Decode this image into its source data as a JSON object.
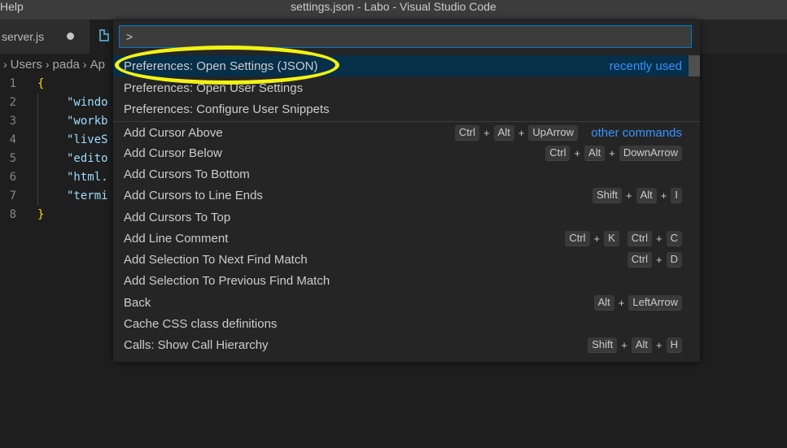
{
  "menu": {
    "help": "Help"
  },
  "window": {
    "title": "settings.json - Labo - Visual Studio Code"
  },
  "tabs": [
    {
      "label": "server.js",
      "modified": true
    },
    {
      "label": "",
      "icon": "file-icon"
    }
  ],
  "breadcrumb": [
    "Users",
    "pada",
    "Ap"
  ],
  "editor": {
    "line_numbers": [
      "1",
      "2",
      "3",
      "4",
      "5",
      "6",
      "7",
      "8"
    ],
    "lines": [
      "{",
      "\"windo",
      "\"workb",
      "\"liveS",
      "\"edito",
      "\"html.",
      "\"termi",
      "}"
    ]
  },
  "palette": {
    "input_value": ">",
    "items": [
      {
        "label": "Preferences: Open Settings (JSON)",
        "tag": "recently used",
        "keys": []
      },
      {
        "label": "Preferences: Open User Settings",
        "tag": "",
        "keys": []
      },
      {
        "label": "Preferences: Configure User Snippets",
        "tag": "",
        "keys": []
      },
      {
        "label": "Add Cursor Above",
        "tag": "other commands",
        "keys": [
          [
            "Ctrl",
            "Alt",
            "UpArrow"
          ]
        ]
      },
      {
        "label": "Add Cursor Below",
        "tag": "",
        "keys": [
          [
            "Ctrl",
            "Alt",
            "DownArrow"
          ]
        ]
      },
      {
        "label": "Add Cursors To Bottom",
        "tag": "",
        "keys": []
      },
      {
        "label": "Add Cursors to Line Ends",
        "tag": "",
        "keys": [
          [
            "Shift",
            "Alt",
            "I"
          ]
        ]
      },
      {
        "label": "Add Cursors To Top",
        "tag": "",
        "keys": []
      },
      {
        "label": "Add Line Comment",
        "tag": "",
        "keys": [
          [
            "Ctrl",
            "K"
          ],
          [
            "Ctrl",
            "C"
          ]
        ]
      },
      {
        "label": "Add Selection To Next Find Match",
        "tag": "",
        "keys": [
          [
            "Ctrl",
            "D"
          ]
        ]
      },
      {
        "label": "Add Selection To Previous Find Match",
        "tag": "",
        "keys": []
      },
      {
        "label": "Back",
        "tag": "",
        "keys": [
          [
            "Alt",
            "LeftArrow"
          ]
        ]
      },
      {
        "label": "Cache CSS class definitions",
        "tag": "",
        "keys": []
      },
      {
        "label": "Calls: Show Call Hierarchy",
        "tag": "",
        "keys": [
          [
            "Shift",
            "Alt",
            "H"
          ]
        ]
      }
    ]
  },
  "colors": {
    "accent": "#007acc",
    "link_blue": "#3794ff",
    "annotation_yellow": "#f2f215",
    "selected_row": "#062f4a"
  }
}
